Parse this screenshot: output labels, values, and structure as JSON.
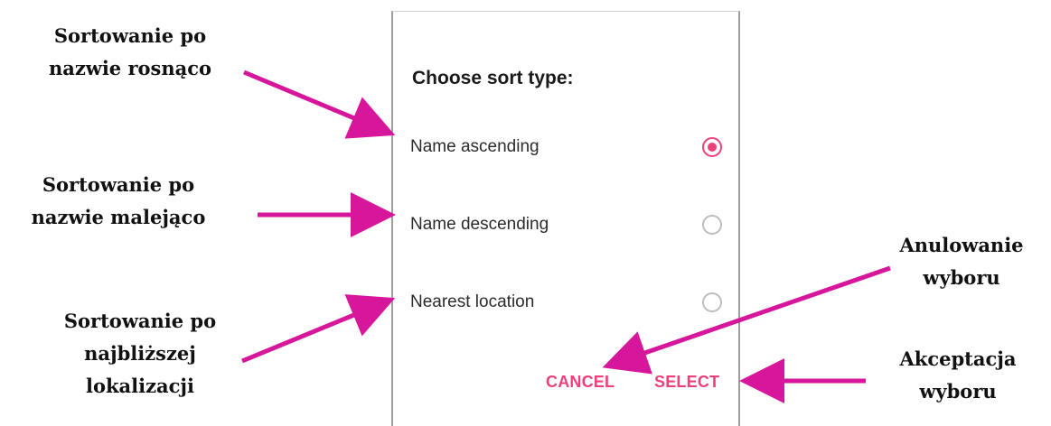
{
  "dialog": {
    "title": "Choose sort type:",
    "options": [
      {
        "label": "Name ascending",
        "selected": true
      },
      {
        "label": "Name descending",
        "selected": false
      },
      {
        "label": "Nearest location",
        "selected": false
      }
    ],
    "cancel_label": "CANCEL",
    "select_label": "SELECT"
  },
  "annotations": {
    "name_asc": [
      "Sortowanie po",
      "nazwie rosnąco"
    ],
    "name_desc": [
      "Sortowanie po",
      "nazwie malejąco"
    ],
    "nearest": [
      "Sortowanie po",
      "najbliższej",
      "lokalizacji"
    ],
    "cancel": [
      "Anulowanie",
      "wyboru"
    ],
    "select": [
      "Akceptacja",
      "wyboru"
    ]
  },
  "colors": {
    "accent": "#ec407a",
    "arrow": "#d6179b"
  }
}
